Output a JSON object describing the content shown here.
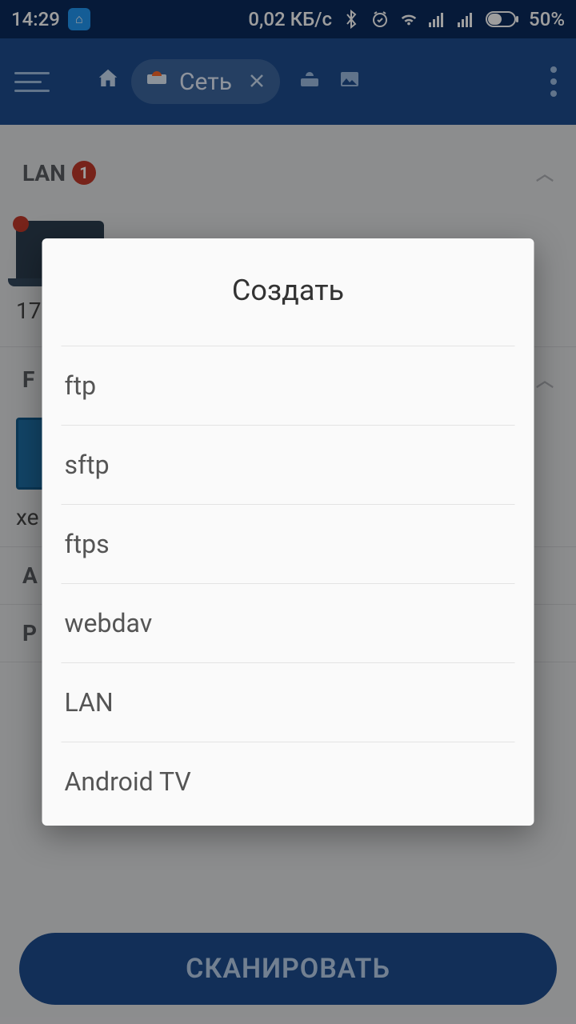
{
  "status": {
    "time": "14:29",
    "data_rate": "0,02 КБ/с",
    "battery": "50%"
  },
  "appbar": {
    "tab_label": "Сеть"
  },
  "sections": {
    "lan": {
      "label": "LAN",
      "badge": "1",
      "device_ip": "17"
    },
    "ftp": {
      "label": "F",
      "server_label": "xe"
    },
    "adb": {
      "label": "A"
    },
    "p": {
      "label": "P"
    }
  },
  "scan_button": "СКАНИРОВАТЬ",
  "dialog": {
    "title": "Создать",
    "options": [
      "ftp",
      "sftp",
      "ftps",
      "webdav",
      "LAN",
      "Android TV"
    ]
  }
}
